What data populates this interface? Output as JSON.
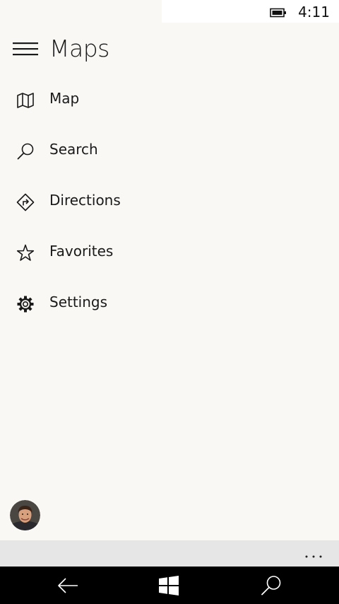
{
  "status_bar": {
    "time": "4:11",
    "battery_icon": "battery-icon"
  },
  "header": {
    "menu_icon": "hamburger-icon",
    "title": "Maps"
  },
  "nav": {
    "items": [
      {
        "label": "Map",
        "icon": "map-icon"
      },
      {
        "label": "Search",
        "icon": "search-icon"
      },
      {
        "label": "Directions",
        "icon": "directions-icon"
      },
      {
        "label": "Favorites",
        "icon": "star-icon"
      },
      {
        "label": "Settings",
        "icon": "gear-icon"
      }
    ]
  },
  "app_bar": {
    "more_icon": "more-icon"
  },
  "system_nav": {
    "back_icon": "back-arrow-icon",
    "start_icon": "windows-logo-icon",
    "search_icon": "search-icon"
  },
  "colors": {
    "background": "#f9f8f5",
    "app_bar": "#e6e6e6",
    "system_nav": "#000000",
    "text": "#1a1a1a"
  }
}
